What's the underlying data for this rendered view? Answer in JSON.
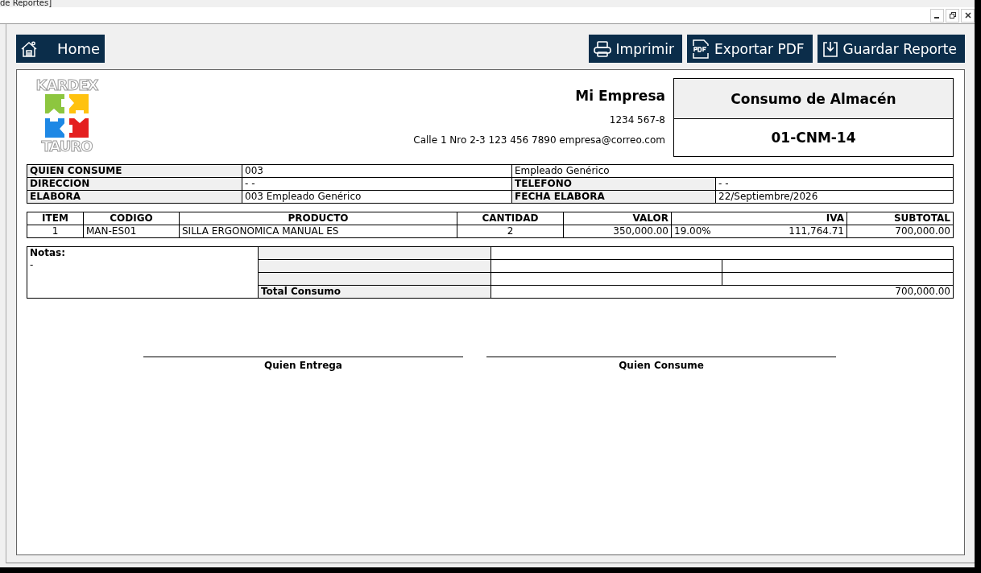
{
  "window": {
    "title": "de Reportes]"
  },
  "toolbar": {
    "home": {
      "label": "Home"
    },
    "actions": [
      {
        "label": "Imprimir",
        "kind": "print"
      },
      {
        "label": "Exportar PDF",
        "kind": "pdf"
      },
      {
        "label": "Guardar Reporte",
        "kind": "save"
      }
    ]
  },
  "report": {
    "logo": {
      "top": "KARDEX",
      "bottom": "TAURO"
    },
    "company": {
      "name": "Mi Empresa",
      "id": "1234 567-8",
      "address": "Calle 1 Nro 2-3 123 456 7890 empresa@correo.com"
    },
    "document": {
      "title": "Consumo de Almacén",
      "number": "01-CNM-14"
    },
    "info": [
      {
        "label": "QUIEN CONSUME",
        "value": "003",
        "extra_value": "Empleado Genérico"
      },
      {
        "label": "DIRECCION",
        "value": "- -",
        "extra_label": "TELEFONO",
        "extra_value": "- -"
      },
      {
        "label": "ELABORA",
        "value": "003 Empleado Genérico",
        "extra_label": "FECHA ELABORA",
        "extra_value": "22/Septiembre/2026"
      }
    ],
    "items": {
      "columns": [
        "ITEM",
        "CODIGO",
        "PRODUCTO",
        "CANTIDAD",
        "VALOR",
        "IVA",
        "SUBTOTAL"
      ],
      "rows": [
        {
          "item": "1",
          "code": "MAN-ES01",
          "product": "SILLA ERGONOMICA MANUAL ES",
          "quantity": "2",
          "value": "350,000.00",
          "tax_rate": "19.00%",
          "tax": "111,764.71",
          "subtotal": "700,000.00"
        }
      ]
    },
    "notes": {
      "label": "Notas:",
      "text": "-"
    },
    "total": {
      "label": "Total Consumo",
      "value": "700,000.00"
    },
    "signatures": [
      "Quien Entrega",
      "Quien Consume"
    ]
  }
}
